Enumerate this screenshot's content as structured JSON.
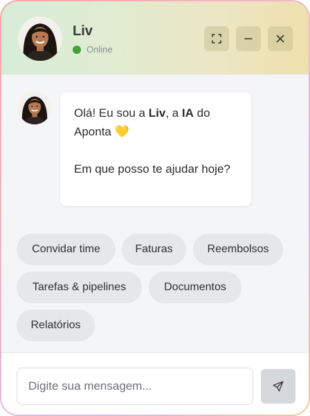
{
  "header": {
    "name": "Liv",
    "status": "Online",
    "status_color": "#3fa33a",
    "buttons": {
      "expand": "expand-icon",
      "minimize": "minimize-icon",
      "close": "close-icon"
    }
  },
  "message": {
    "greeting_prefix": "Olá! Eu sou a ",
    "name": "Liv",
    "mid": ", a ",
    "ia": "IA",
    "suffix": " do Aponta ",
    "emoji": "💛",
    "question": "Em que posso te ajudar hoje?"
  },
  "suggestions": [
    "Convidar time",
    "Faturas",
    "Reembolsos",
    "Tarefas & pipelines",
    "Documentos",
    "Relatórios"
  ],
  "composer": {
    "placeholder": "Digite sua mensagem...",
    "send_icon": "send-icon"
  }
}
